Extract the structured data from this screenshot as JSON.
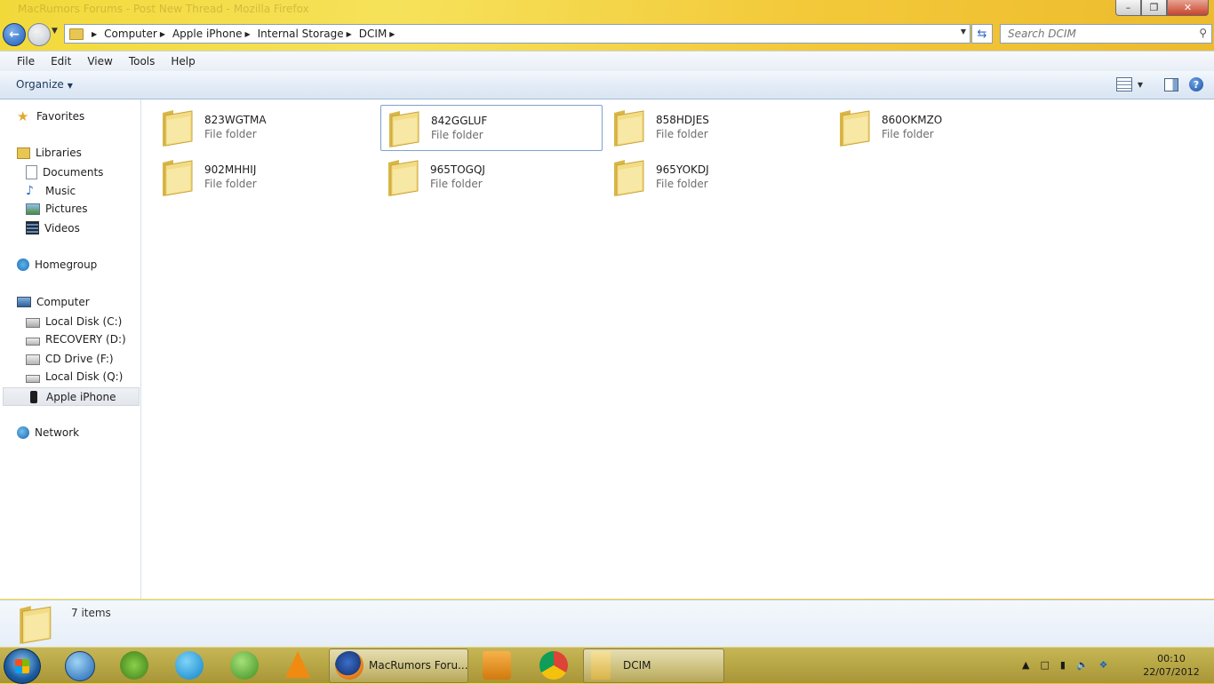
{
  "window": {
    "title": "MacRumors Forums - Post New Thread - Mozilla Firefox",
    "minimize": "–",
    "maximize": "❐",
    "close": "✕"
  },
  "address": {
    "crumbs": [
      "Computer",
      "Apple iPhone",
      "Internal Storage",
      "DCIM"
    ],
    "search_placeholder": "Search DCIM"
  },
  "menu": [
    "File",
    "Edit",
    "View",
    "Tools",
    "Help"
  ],
  "command": {
    "organize": "Organize"
  },
  "nav": {
    "favorites": "Favorites",
    "libraries": "Libraries",
    "documents": "Documents",
    "music": "Music",
    "pictures": "Pictures",
    "videos": "Videos",
    "homegroup": "Homegroup",
    "computer": "Computer",
    "drives": [
      "Local Disk (C:)",
      "RECOVERY (D:)",
      "CD Drive (F:)",
      "Local Disk (Q:)",
      "Apple iPhone"
    ],
    "network": "Network"
  },
  "folders": [
    {
      "name": "823WGTMA",
      "type": "File folder"
    },
    {
      "name": "842GGLUF",
      "type": "File folder"
    },
    {
      "name": "858HDJES",
      "type": "File folder"
    },
    {
      "name": "860OKMZO",
      "type": "File folder"
    },
    {
      "name": "902MHHIJ",
      "type": "File folder"
    },
    {
      "name": "965TOGQJ",
      "type": "File folder"
    },
    {
      "name": "965YOKDJ",
      "type": "File folder"
    }
  ],
  "details": {
    "count": "7 items"
  },
  "taskbar": {
    "firefox_label": "MacRumors Foru...",
    "explorer_label": "DCIM",
    "time": "00:10",
    "date": "22/07/2012"
  },
  "colors": {
    "accent": "#1d5bb5",
    "selection": "#7da2ce",
    "folder": "#e8c653"
  }
}
